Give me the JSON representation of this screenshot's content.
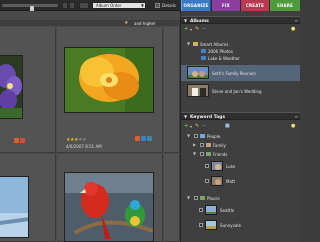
{
  "toolbar": {
    "sort_value": "Album Order",
    "details_checked": true,
    "details_label": "Details"
  },
  "tabs": {
    "organize": "ORGANIZE",
    "fix": "FIX",
    "create": "CREATE",
    "share": "SHARE",
    "active": "organize"
  },
  "browser": {
    "rating_filter": "and higher",
    "photos": [
      {
        "name": "purple-flower",
        "date": ""
      },
      {
        "name": "yellow-poppy",
        "date": "4/6/2007 8:51 AM",
        "stars": 3
      },
      {
        "name": "landscape",
        "date": ""
      },
      {
        "name": "parrot",
        "date": ""
      }
    ]
  },
  "albums_panel": {
    "title": "Albums",
    "smart_albums": "Smart Albums",
    "items": [
      {
        "label": "2006 Photos"
      },
      {
        "label": "Lake & Weather"
      },
      {
        "label": "Seth's Family Reunion"
      },
      {
        "label": "Steve and Jan's Wedding"
      }
    ]
  },
  "tags_panel": {
    "title": "Keyword Tags",
    "people": "People",
    "family": "Family",
    "friends": "Friends",
    "people_tags": [
      "Luke",
      "Matt"
    ],
    "places": "Places",
    "place_tags": [
      "Seattle",
      "Sunnyvale"
    ]
  },
  "colors": {
    "organize": "#3a7bc9",
    "fix": "#8a3f9e",
    "create": "#b83a52",
    "share": "#4f9a3a",
    "selection": "#55657a",
    "star": "#e9b928"
  }
}
